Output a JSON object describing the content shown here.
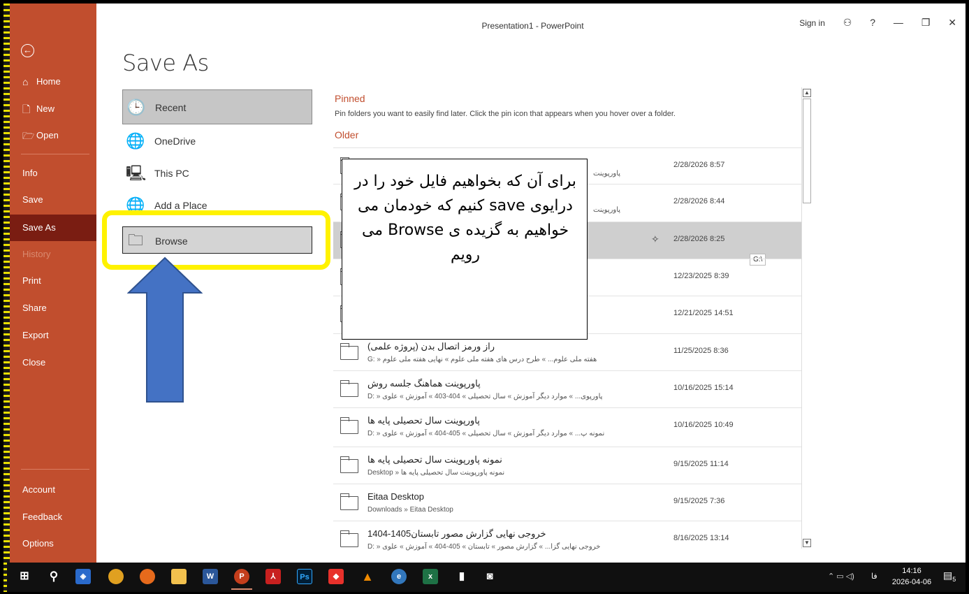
{
  "window": {
    "title": "Presentation1  -  PowerPoint",
    "sign_in": "Sign in",
    "help": "?",
    "minimize": "—",
    "restore": "❐",
    "close": "✕"
  },
  "nav": {
    "home": "Home",
    "new": "New",
    "open": "Open",
    "info": "Info",
    "save": "Save",
    "save_as": "Save As",
    "history": "History",
    "print": "Print",
    "share": "Share",
    "export": "Export",
    "close": "Close",
    "account": "Account",
    "feedback": "Feedback",
    "options": "Options"
  },
  "page_title": "Save As",
  "places": {
    "recent": "Recent",
    "onedrive": "OneDrive",
    "this_pc": "This PC",
    "add_place": "Add a Place",
    "browse": "Browse"
  },
  "pinned": {
    "heading": "Pinned",
    "description": "Pin folders you want to easily find later. Click the pin icon that appears when you hover over a folder."
  },
  "older_heading": "Older",
  "folders": [
    {
      "name": "",
      "path": "پاورپوینت",
      "date": "2/28/2026 8:57"
    },
    {
      "name": "",
      "path": "پاورپوینت",
      "date": "2/28/2026 8:44"
    },
    {
      "name": "",
      "path": "",
      "date": "2/28/2026 8:25",
      "tip": "G:\\"
    },
    {
      "name": "",
      "path": "",
      "date": "12/23/2025 8:39"
    },
    {
      "name": "",
      "path": "",
      "date": "12/21/2025 14:51"
    },
    {
      "name": "راز ورمز اتصال بدن (پروژه علمی)",
      "path": "G: » هفته ملی علوم... » طرح درس های هفته ملی علوم » نهایی هفته ملی علوم",
      "date": "11/25/2025 8:36"
    },
    {
      "name": "پاورپوینت هماهنگ جلسه روش",
      "path": "D: » پاورپوی... » موارد دیگر آموزش » سال تحصیلی » 404-403 » آموزش » علوی",
      "date": "10/16/2025 15:14"
    },
    {
      "name": "پاورپوینت سال تحصیلی پایه ها",
      "path": "D: » نمونه پ... » موارد دیگر آموزش » سال تحصیلی » 405-404 » آموزش » علوی",
      "date": "10/16/2025 10:49"
    },
    {
      "name": "نمونه پاورپوینت سال تحصیلی پایه ها",
      "path": "Desktop » نمونه پاورپوینت سال تحصیلی پایه ها",
      "date": "9/15/2025 11:14"
    },
    {
      "name": "Eitaa Desktop",
      "path": "Downloads » Eitaa Desktop",
      "date": "9/15/2025 7:36"
    },
    {
      "name": "خروجی نهایی گزارش مصور تابستان1405-1404",
      "path": "D: » خروجی نهایی گزا... » گزارش مصور » تابستان » 405-404 » آموزش » علوی",
      "date": "8/16/2025 13:14"
    }
  ],
  "callout": {
    "text": "برای آن که بخواهیم فایل خود را در درایوی  save کنیم که خودمان می خواهیم به گزیده ی Browse می رویم"
  },
  "taskbar": {
    "lang": "فا",
    "time": "14:16",
    "date": "2026-04-06",
    "notif_count": "5",
    "apps": [
      "chrome",
      "firefox",
      "file-explorer",
      "word",
      "powerpoint",
      "acrobat",
      "photoshop",
      "anydesk",
      "vlc",
      "edge",
      "excel",
      "usb-tool",
      "camera"
    ]
  },
  "colors": {
    "nav_bg": "#c14e2e",
    "nav_selected": "#7a1d12",
    "accent": "#c14e2e",
    "highlight_ring": "#fff200",
    "arrow": "#4472c4"
  }
}
